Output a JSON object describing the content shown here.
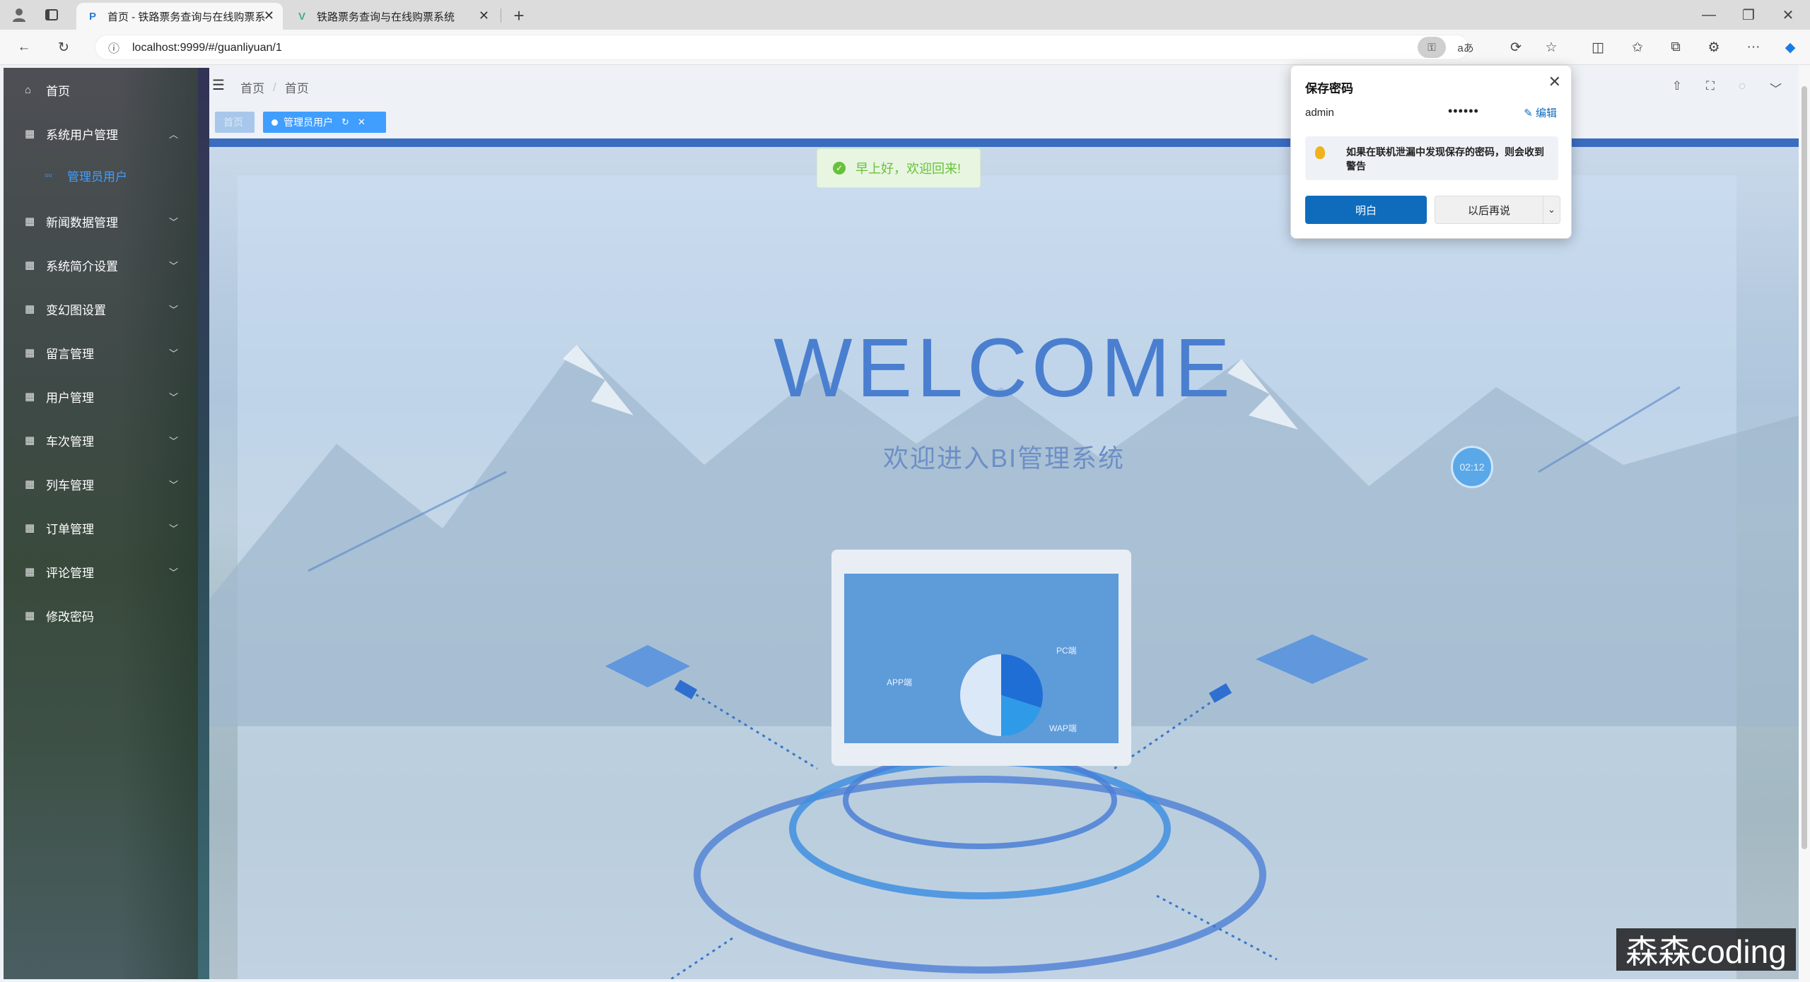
{
  "browser": {
    "tabs": [
      {
        "title": "首页 - 铁路票务查询与在线购票系",
        "active": true
      },
      {
        "title": "铁路票务查询与在线购票系统",
        "active": false
      }
    ],
    "url": "localhost:9999/#/guanliyuan/1"
  },
  "sidebar": {
    "items": [
      {
        "label": "首页",
        "icon": "home-icon",
        "expandable": false
      },
      {
        "label": "系统用户管理",
        "icon": "grid-icon",
        "expandable": true,
        "expanded": true
      },
      {
        "label": "新闻数据管理",
        "icon": "grid-icon",
        "expandable": true
      },
      {
        "label": "系统简介设置",
        "icon": "grid-icon",
        "expandable": true
      },
      {
        "label": "变幻图设置",
        "icon": "grid-icon",
        "expandable": true
      },
      {
        "label": "留言管理",
        "icon": "grid-icon",
        "expandable": true
      },
      {
        "label": "用户管理",
        "icon": "grid-icon",
        "expandable": true
      },
      {
        "label": "车次管理",
        "icon": "grid-icon",
        "expandable": true
      },
      {
        "label": "列车管理",
        "icon": "grid-icon",
        "expandable": true
      },
      {
        "label": "订单管理",
        "icon": "grid-icon",
        "expandable": true
      },
      {
        "label": "评论管理",
        "icon": "grid-icon",
        "expandable": true
      },
      {
        "label": "修改密码",
        "icon": "grid-icon",
        "expandable": false
      }
    ],
    "subitems": [
      {
        "label": "管理员用户",
        "icon": "apps-icon"
      }
    ]
  },
  "header": {
    "breadcrumb": [
      "首页",
      "首页"
    ]
  },
  "tags": {
    "home": "首页",
    "active": "管理员用户"
  },
  "toast": {
    "message": "早上好，欢迎回来!"
  },
  "welcome": {
    "title": "WELCOME",
    "subtitle": "欢迎进入BI管理系统",
    "timer": "02:12",
    "monitor_labels": {
      "pc": "PC端",
      "app": "APP端",
      "wap": "WAP端"
    }
  },
  "password_popup": {
    "title": "保存密码",
    "username": "admin",
    "password_mask": "••••••",
    "edit_label": "编辑",
    "info": "如果在联机泄漏中发现保存的密码，则会收到警告",
    "ok_label": "明白",
    "later_label": "以后再说"
  },
  "watermark": "森森coding",
  "colors": {
    "accent": "#409eff",
    "edge_primary": "#0f6cbd",
    "success": "#67c23a",
    "welcome_text": "#4a7fd0"
  }
}
